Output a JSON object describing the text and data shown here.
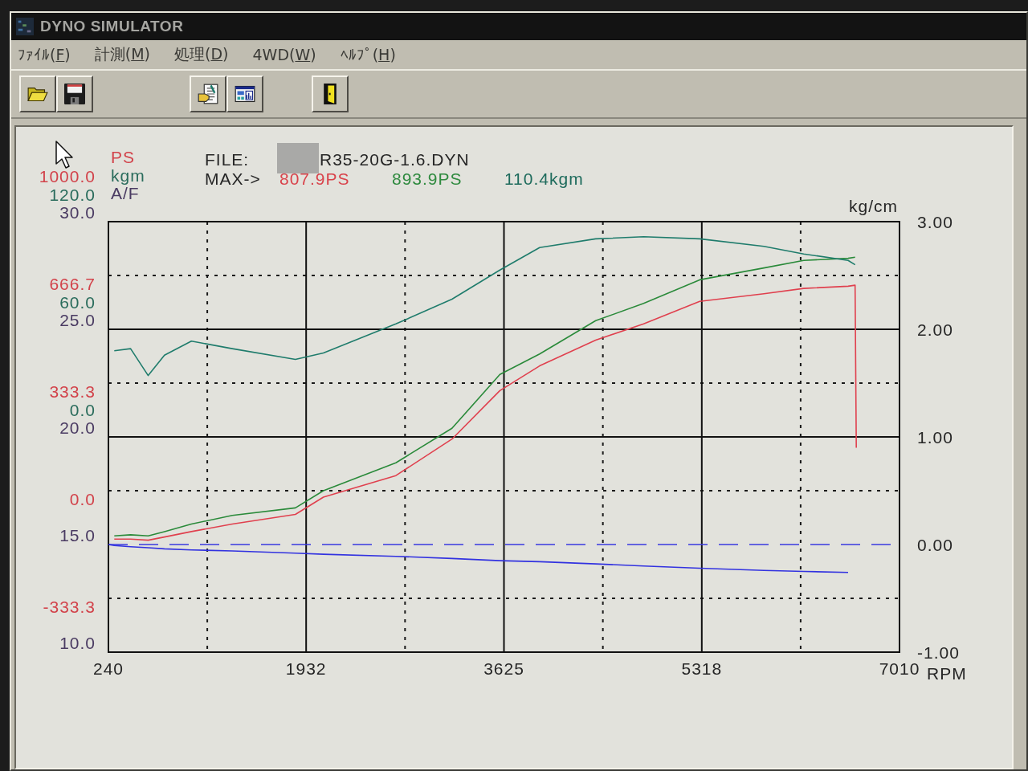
{
  "window": {
    "title": "DYNO SIMULATOR"
  },
  "menu": [
    {
      "before": "ﾌｧｲﾙ(",
      "key": "F",
      "after": ")"
    },
    {
      "before": "計測(",
      "key": "M",
      "after": ")"
    },
    {
      "before": "処理(",
      "key": "D",
      "after": ")"
    },
    {
      "before": "4WD(",
      "key": "W",
      "after": ")"
    },
    {
      "before": "ﾍﾙﾌﾟ(",
      "key": "H",
      "after": ")"
    }
  ],
  "graph": {
    "units": [
      {
        "kind": "ps",
        "text": "PS",
        "color": "#d2434b"
      },
      {
        "kind": "kgm",
        "text": "kgm",
        "color": "#2a6c5c"
      },
      {
        "kind": "af",
        "text": "A/F",
        "color": "#4a3b62"
      }
    ],
    "file": {
      "label": "FILE:",
      "redacted": true,
      "name": "R35-20G-1.6.DYN"
    },
    "max": {
      "label": "MAX->",
      "values": [
        {
          "text": "807.9PS",
          "color": "#d9434b"
        },
        {
          "text": "893.9PS",
          "color": "#2f8a3f"
        },
        {
          "text": "110.4kgm",
          "color": "#1e6b5c"
        }
      ]
    },
    "left_axis": [
      {
        "labels": [
          {
            "kind": "ps",
            "text": "1000.0"
          },
          {
            "kind": "kgm",
            "text": "120.0"
          },
          {
            "kind": "af",
            "text": "30.0"
          }
        ]
      },
      {
        "labels": [
          {
            "kind": "ps",
            "text": "666.7"
          },
          {
            "kind": "kgm",
            "text": "60.0"
          },
          {
            "kind": "af",
            "text": "25.0"
          }
        ]
      },
      {
        "labels": [
          {
            "kind": "ps",
            "text": "333.3"
          },
          {
            "kind": "kgm",
            "text": "0.0"
          },
          {
            "kind": "af",
            "text": "20.0"
          }
        ]
      },
      {
        "labels": [
          {
            "kind": "ps",
            "text": "0.0"
          },
          {
            "kind": "af",
            "text": "15.0"
          }
        ]
      },
      {
        "labels": [
          {
            "kind": "ps",
            "text": "-333.3"
          },
          {
            "kind": "af",
            "text": "10.0"
          }
        ]
      }
    ],
    "chart_data": {
      "type": "line",
      "xlabel": "RPM",
      "ylabel": "kg/cm",
      "x": [
        240,
        290,
        430,
        580,
        720,
        950,
        1300,
        1840,
        2080,
        2700,
        3180,
        3590,
        3930,
        4410,
        4820,
        5300,
        5850,
        6190,
        6570,
        6630,
        6640
      ],
      "xlim": [
        240,
        7010
      ],
      "ylim": [
        -1,
        3
      ],
      "xticks": [
        240,
        1932,
        3625,
        5318,
        7010
      ],
      "yticks": [
        {
          "value": 3,
          "label": "3.00"
        },
        {
          "value": 2,
          "label": "2.00"
        },
        {
          "value": 1,
          "label": "1.00"
        },
        {
          "value": 0,
          "label": "0.00"
        },
        {
          "value": -1,
          "label": "-1.00"
        }
      ],
      "grid": true,
      "ref_lines": [
        {
          "axis": "y",
          "value": 0,
          "color": "#3a3ae0"
        }
      ],
      "series": [
        {
          "color": "#e0404e",
          "values": [
            null,
            0.05,
            0.05,
            0.04,
            0.07,
            0.12,
            0.19,
            0.28,
            0.44,
            0.64,
            0.98,
            1.43,
            1.66,
            1.9,
            2.05,
            2.26,
            2.33,
            2.38,
            2.4,
            2.41,
            0.9
          ]
        },
        {
          "color": "#2a8a3a",
          "values": [
            null,
            0.08,
            0.09,
            0.08,
            0.12,
            0.19,
            0.27,
            0.34,
            0.5,
            0.76,
            1.08,
            1.58,
            1.77,
            2.08,
            2.24,
            2.46,
            2.57,
            2.64,
            2.66,
            2.67,
            null
          ]
        },
        {
          "color": "#1f7c6c",
          "values": [
            null,
            1.8,
            1.82,
            1.57,
            1.76,
            1.89,
            1.82,
            1.72,
            1.78,
            2.05,
            2.28,
            2.55,
            2.76,
            2.84,
            2.86,
            2.84,
            2.77,
            2.7,
            2.64,
            2.6,
            null
          ]
        },
        {
          "color": "#3232e0",
          "values": [
            0.0,
            -0.01,
            -0.02,
            -0.03,
            -0.04,
            -0.05,
            -0.06,
            -0.08,
            -0.09,
            -0.11,
            -0.13,
            -0.15,
            -0.16,
            -0.18,
            -0.2,
            -0.22,
            -0.24,
            -0.25,
            -0.26,
            null,
            null
          ]
        }
      ]
    }
  }
}
